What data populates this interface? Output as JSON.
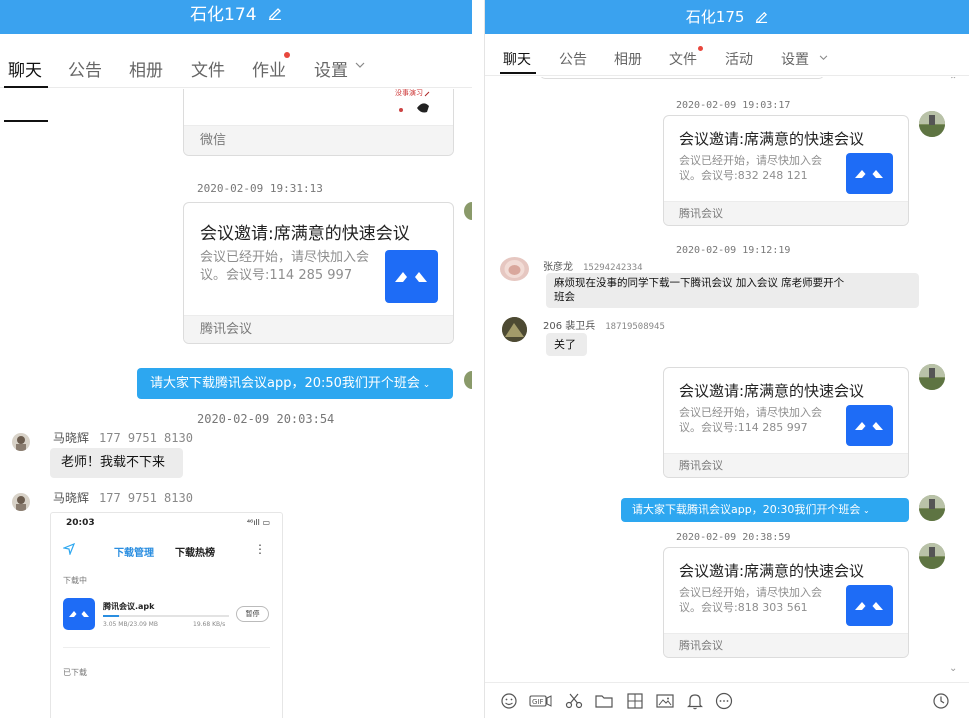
{
  "left": {
    "title": "石化174",
    "tabs": [
      "聊天",
      "公告",
      "相册",
      "文件",
      "作业",
      "设置"
    ],
    "top_card_footer": "微信",
    "top_card_image_text": "没事演习",
    "ts1": "2020-02-09 19:31:13",
    "card1": {
      "title": "会议邀请:席满意的快速会议",
      "desc_line1": "会议已经开始，请尽快加入会",
      "desc_line2": "议。会议号:114 285 997",
      "footer": "腾讯会议"
    },
    "out_msg": "请大家下载腾讯会议app，20:50我们开个班会",
    "ts2": "2020-02-09 20:03:54",
    "msg1": {
      "name": "马晓辉",
      "phone": "177 9751 8130",
      "text": "老师！我载不下来"
    },
    "msg2": {
      "name": "马晓辉",
      "phone": "177 9751 8130"
    },
    "phone_shot": {
      "time": "20:03",
      "signal": "⁴⁶ıll ▭",
      "tab_active": "下载管理",
      "tab_other": "下载热榜",
      "section1": "下载中",
      "app_name": "腾讯会议.apk",
      "progress": 0.13,
      "size": "3.05 MB/23.09 MB",
      "speed": "19.68 KB/s",
      "pause": "暂停",
      "section2": "已下载"
    }
  },
  "right": {
    "title": "石化175",
    "tabs": [
      "聊天",
      "公告",
      "相册",
      "文件",
      "活动",
      "设置"
    ],
    "ts1": "2020-02-09 19:03:17",
    "card1": {
      "title": "会议邀请:席满意的快速会议",
      "desc_line1": "会议已经开始，请尽快加入会",
      "desc_line2": "议。会议号:832 248 121",
      "footer": "腾讯会议"
    },
    "ts2": "2020-02-09 19:12:19",
    "msg1": {
      "name": "张彦龙",
      "phone": "15294242334",
      "line1": "麻烦现在没事的同学下载一下腾讯会议   加入会议  席老师要开个",
      "line2": "班会"
    },
    "msg2": {
      "name": "206  裴卫兵",
      "phone": "18719508945",
      "text": "关了"
    },
    "card2": {
      "title": "会议邀请:席满意的快速会议",
      "desc_line1": "会议已经开始，请尽快加入会",
      "desc_line2": "议。会议号:114 285 997",
      "footer": "腾讯会议"
    },
    "out_msg": "请大家下载腾讯会议app，20:30我们开个班会",
    "ts3": "2020-02-09 20:38:59",
    "card3": {
      "title": "会议邀请:席满意的快速会议",
      "desc_line1": "会议已经开始，请尽快加入会",
      "desc_line2": "议。会议号:818 303 561",
      "footer": "腾讯会议"
    },
    "toolbar_icons": [
      "smiley-icon",
      "gif-icon",
      "scissors-icon",
      "folder-icon",
      "image-group-icon",
      "image-icon",
      "bell-icon",
      "more-icon",
      "history-icon"
    ]
  },
  "colors": {
    "accent": "#3aa2ef",
    "bubble_out": "#2da7f0",
    "bubble_in": "#ececec",
    "tencent_meeting": "#1e6cf6",
    "badge": "#e8473d"
  }
}
